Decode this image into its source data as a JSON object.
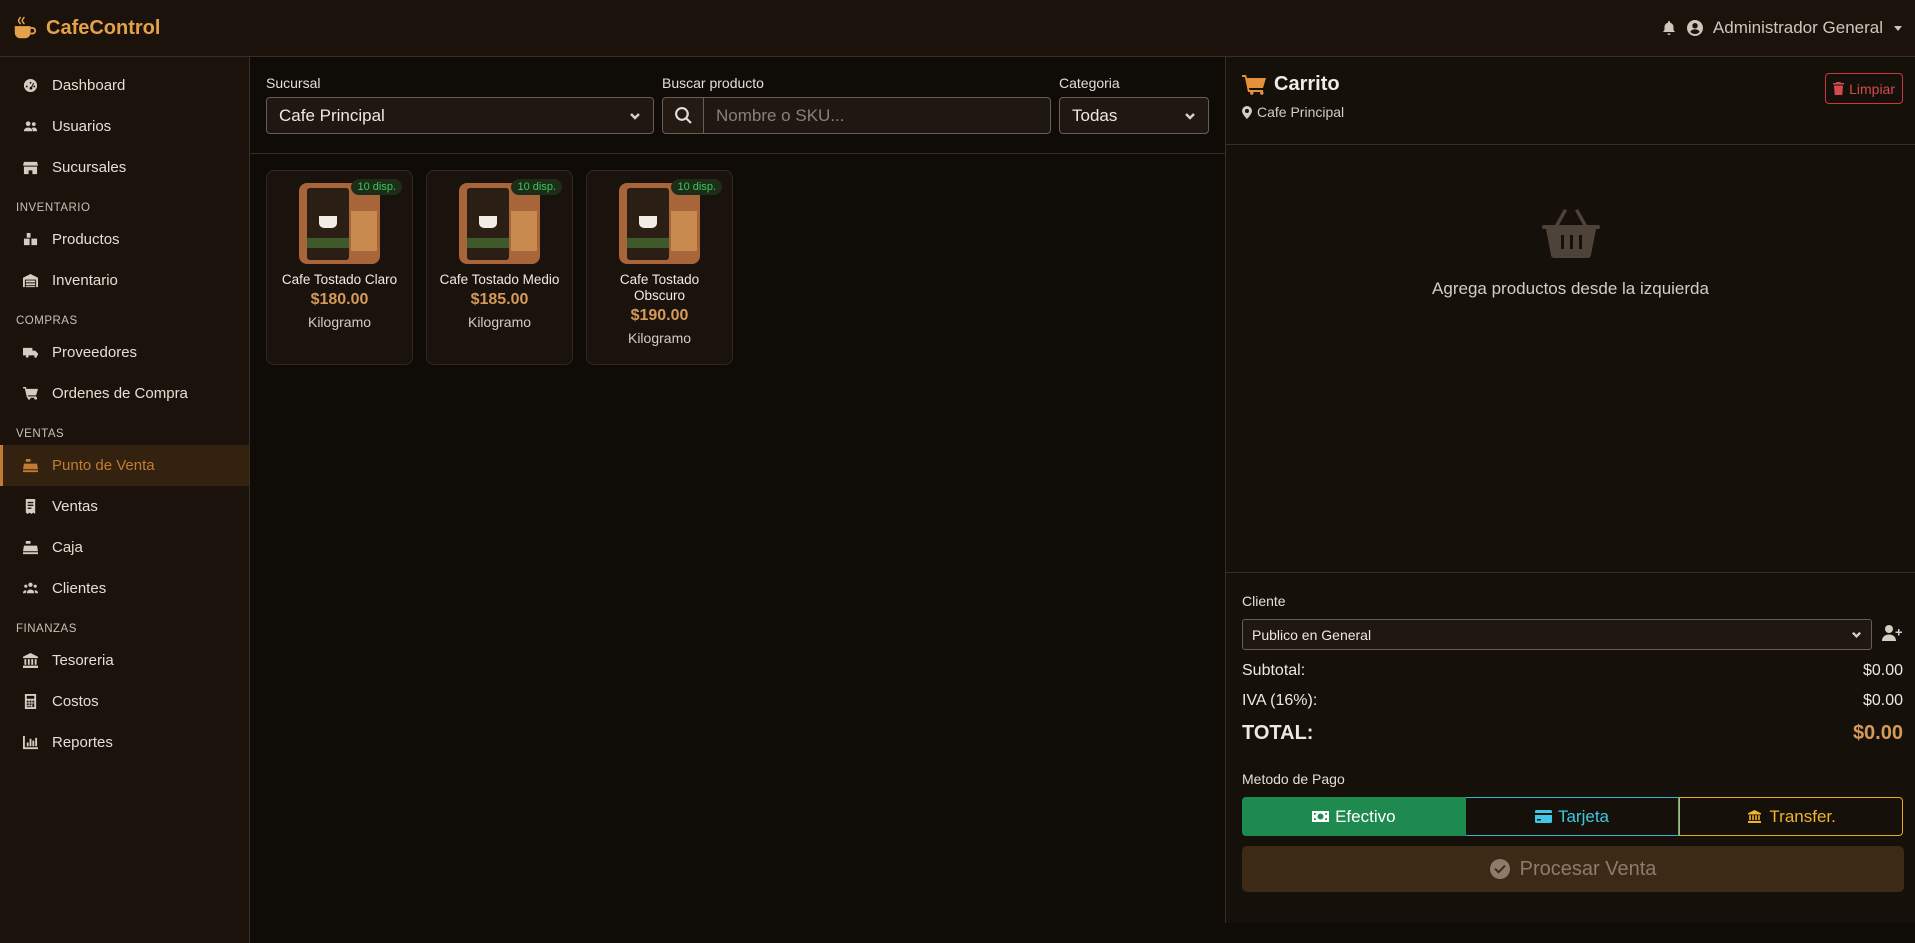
{
  "app": {
    "name": "CafeControl"
  },
  "header": {
    "user_name": "Administrador General"
  },
  "sidebar": {
    "groups": [
      {
        "label": "",
        "items": [
          {
            "label": "Dashboard",
            "icon": "gauge-icon"
          },
          {
            "label": "Usuarios",
            "icon": "users-icon"
          },
          {
            "label": "Sucursales",
            "icon": "store-icon"
          }
        ]
      },
      {
        "label": "INVENTARIO",
        "items": [
          {
            "label": "Productos",
            "icon": "boxes-icon"
          },
          {
            "label": "Inventario",
            "icon": "warehouse-icon"
          }
        ]
      },
      {
        "label": "COMPRAS",
        "items": [
          {
            "label": "Proveedores",
            "icon": "truck-icon"
          },
          {
            "label": "Ordenes de Compra",
            "icon": "cart-icon"
          }
        ]
      },
      {
        "label": "VENTAS",
        "items": [
          {
            "label": "Punto de Venta",
            "icon": "cash-register-icon",
            "active": true
          },
          {
            "label": "Ventas",
            "icon": "receipt-icon"
          },
          {
            "label": "Caja",
            "icon": "cash-box-icon"
          },
          {
            "label": "Clientes",
            "icon": "people-icon"
          }
        ]
      },
      {
        "label": "FINANZAS",
        "items": [
          {
            "label": "Tesoreria",
            "icon": "bank-icon"
          },
          {
            "label": "Costos",
            "icon": "calculator-icon"
          },
          {
            "label": "Reportes",
            "icon": "chart-icon"
          }
        ]
      }
    ]
  },
  "filters": {
    "branch_label": "Sucursal",
    "branch_value": "Cafe Principal",
    "search_label": "Buscar producto",
    "search_placeholder": "Nombre o SKU...",
    "category_label": "Categoria",
    "category_value": "Todas"
  },
  "products": [
    {
      "name": "Cafe Tostado Claro",
      "price": "$180.00",
      "unit": "Kilogramo",
      "stock": "10 disp."
    },
    {
      "name": "Cafe Tostado Medio",
      "price": "$185.00",
      "unit": "Kilogramo",
      "stock": "10 disp."
    },
    {
      "name": "Cafe Tostado Obscuro",
      "price": "$190.00",
      "unit": "Kilogramo",
      "stock": "10 disp."
    }
  ],
  "cart": {
    "title": "Carrito",
    "branch": "Cafe Principal",
    "clear_label": "Limpiar",
    "empty_message": "Agrega productos desde la izquierda",
    "client_label": "Cliente",
    "client_value": "Publico en General",
    "subtotal_label": "Subtotal:",
    "subtotal_value": "$0.00",
    "tax_label": "IVA (16%):",
    "tax_value": "$0.00",
    "total_label": "TOTAL:",
    "total_value": "$0.00",
    "payment_label": "Metodo de Pago",
    "payment_cash": "Efectivo",
    "payment_card": "Tarjeta",
    "payment_transfer": "Transfer.",
    "process_label": "Procesar Venta"
  },
  "colors": {
    "accent": "#e3a24a",
    "active_nav": "#c27b33",
    "cash": "#1e8a4f",
    "card": "#2fb5d3",
    "transfer": "#e6ad1b",
    "danger": "#c93a40"
  }
}
